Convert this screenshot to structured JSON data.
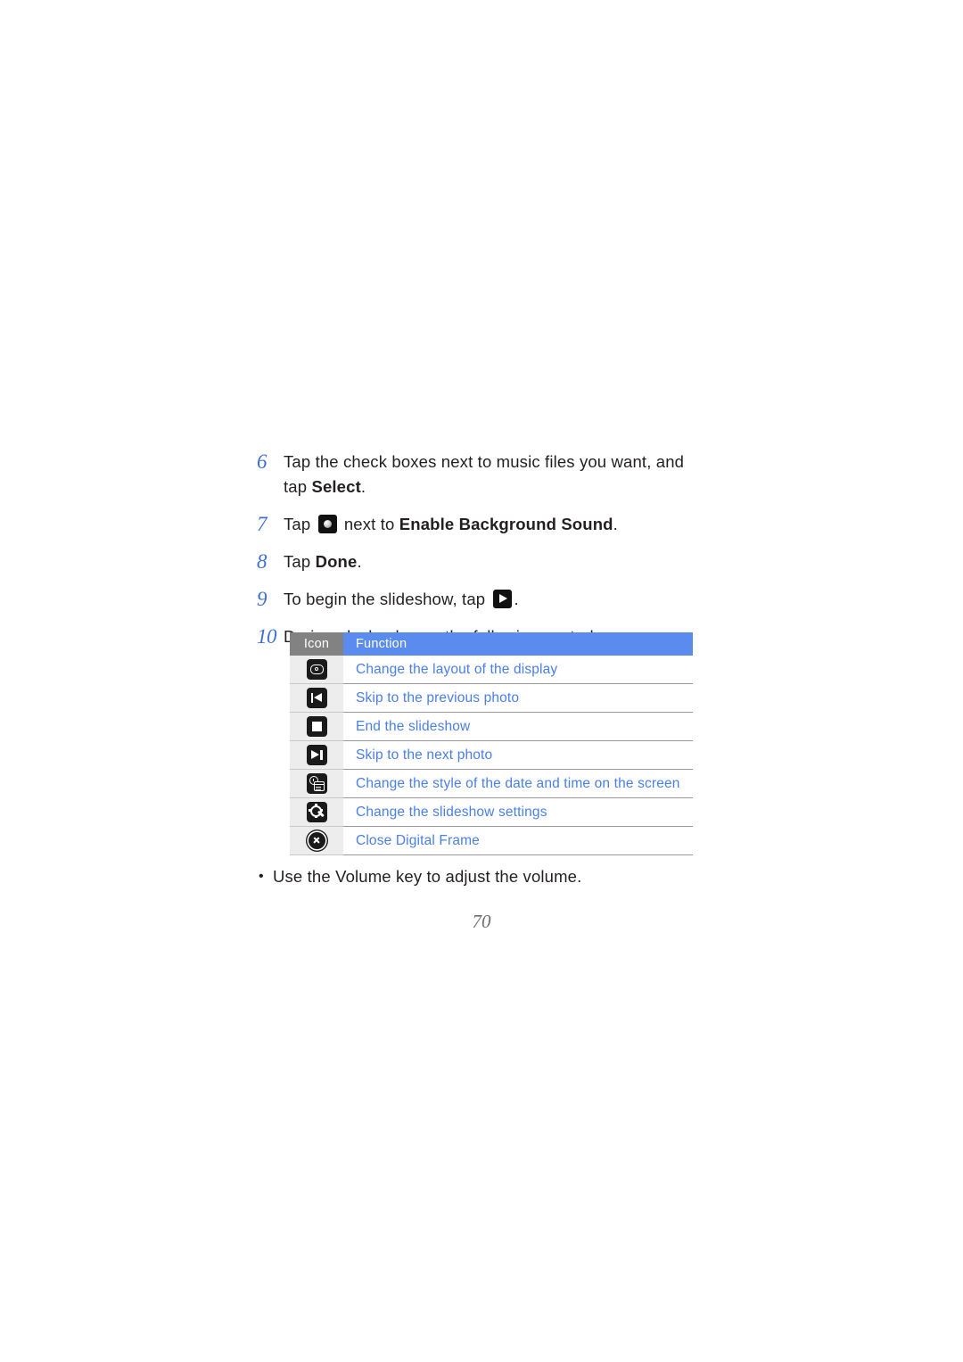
{
  "document": {
    "page_number": "70"
  },
  "steps": [
    {
      "number": "6",
      "text_before": "Tap the check boxes next to music files you want, and tap ",
      "bold": "Select",
      "text_after": ".",
      "icon": null
    },
    {
      "number": "7",
      "text_before": "Tap ",
      "icon": "background-sound-icon",
      "text_middle": " next to ",
      "bold": "Enable Background Sound",
      "text_after": "."
    },
    {
      "number": "8",
      "text_before": "Tap ",
      "bold": "Done",
      "text_after": ".",
      "icon": null
    },
    {
      "number": "9",
      "text_before": "To begin the slideshow, tap ",
      "icon": "play-icon",
      "text_after": ".",
      "bold": ""
    },
    {
      "number": "10",
      "text_before": "During playback, use the following controls:",
      "bold": "",
      "text_after": "",
      "icon": null
    }
  ],
  "controls_table": {
    "headers": {
      "icon": "Icon",
      "function": "Function"
    },
    "rows": [
      {
        "icon_name": "layout-icon",
        "function": "Change the layout of the display"
      },
      {
        "icon_name": "previous-icon",
        "function": "Skip to the previous photo"
      },
      {
        "icon_name": "stop-icon",
        "function": "End the slideshow"
      },
      {
        "icon_name": "next-icon",
        "function": "Skip to the next photo"
      },
      {
        "icon_name": "datetime-icon",
        "function": "Change the style of the date and time on the screen"
      },
      {
        "icon_name": "settings-gear-icon",
        "function": "Change the slideshow settings"
      },
      {
        "icon_name": "close-icon",
        "function": "Close Digital Frame"
      }
    ]
  },
  "note": {
    "bullet": "•",
    "text": "Use the Volume key to adjust the volume."
  },
  "colors": {
    "step_number": "#3f6fd2",
    "link_blue": "#4a7fe8",
    "header_blue": "#5a8cf0",
    "header_gray": "#828282",
    "icon_cell_bg": "#ededed",
    "body_text": "#231f20",
    "page_number": "#6d6d6d"
  }
}
